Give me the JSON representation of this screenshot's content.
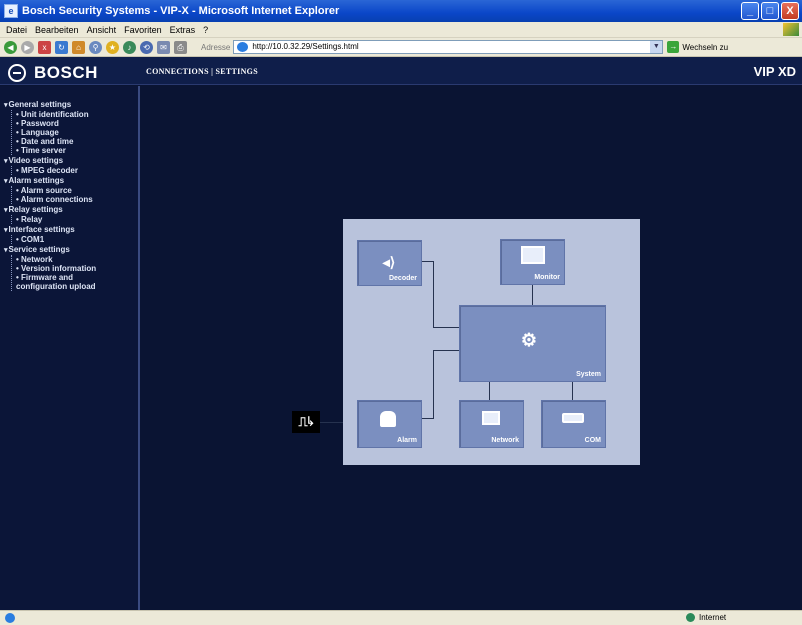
{
  "window": {
    "title": "Bosch Security Systems - VIP-X - Microsoft Internet Explorer",
    "controls": [
      "_",
      "□",
      "X"
    ]
  },
  "menu": [
    "Datei",
    "Bearbeiten",
    "Ansicht",
    "Favoriten",
    "Extras",
    "?"
  ],
  "address": {
    "label": "Adresse",
    "url": "http://10.0.32.29/Settings.html",
    "go_label": "Wechseln zu"
  },
  "header": {
    "brand": "BOSCH",
    "nav": "CONNECTIONS | SETTINGS",
    "product": "VIP XD"
  },
  "sidebar": {
    "sections": [
      {
        "title": "General settings",
        "items": [
          "Unit identification",
          "Password",
          "Language",
          "Date and time",
          "Time server"
        ]
      },
      {
        "title": "Video settings",
        "items": [
          "MPEG decoder"
        ]
      },
      {
        "title": "Alarm settings",
        "items": [
          "Alarm source",
          "Alarm connections"
        ]
      },
      {
        "title": "Relay settings",
        "items": [
          "Relay"
        ]
      },
      {
        "title": "Interface settings",
        "items": [
          "COM1"
        ]
      },
      {
        "title": "Service settings",
        "items": [
          "Network",
          "Version information",
          "Firmware and",
          "configuration upload"
        ]
      }
    ]
  },
  "diagram": {
    "decoder": "Decoder",
    "monitor": "Monitor",
    "system": "System",
    "alarm": "Alarm",
    "network": "Network",
    "com": "COM"
  },
  "status": {
    "zone": "Internet"
  },
  "colors": {
    "background": "#0a1433",
    "panel": "#b9c3dc",
    "box": "#7b8fc0"
  }
}
